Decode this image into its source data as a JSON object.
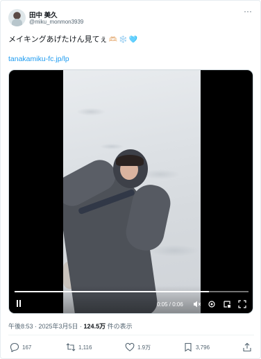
{
  "author": {
    "display_name": "田中 美久",
    "handle": "@miku_monmon3939"
  },
  "tweet": {
    "text": "メイキングあげたけん見てぇ",
    "emojis": [
      "🫶🏻",
      "❄️",
      "🩵"
    ],
    "link": "tanakamiku-fc.jp/lp"
  },
  "video": {
    "time": "0:05 / 0:06",
    "progress": 0.83
  },
  "meta": {
    "timestamp": "午後8:53 · 2025年3月5日 · ",
    "views_count": "124.5万",
    "views_label": " 件の表示"
  },
  "actions": {
    "replies": "167",
    "retweets": "1,116",
    "likes": "1.9万",
    "bookmarks": "3,796"
  },
  "colors": {
    "accent": "#1d9bf0",
    "secondary_text": "#536471"
  }
}
